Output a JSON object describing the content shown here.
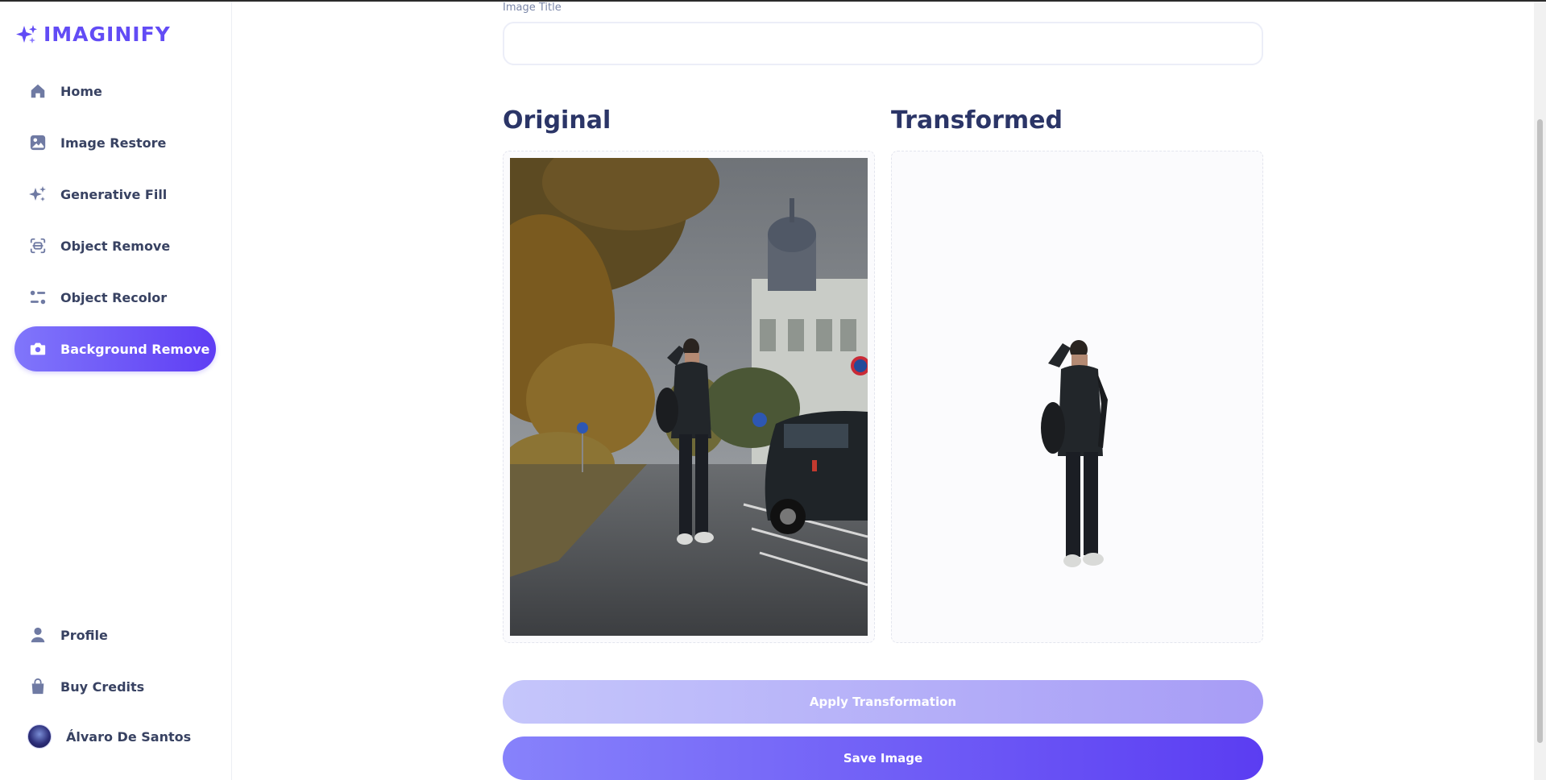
{
  "app": {
    "name": "IMAGINIFY",
    "brand_color": "#624cf5"
  },
  "sidebar": {
    "items": [
      {
        "label": "Home",
        "icon": "home-icon"
      },
      {
        "label": "Image Restore",
        "icon": "image-icon"
      },
      {
        "label": "Generative Fill",
        "icon": "stars-icon"
      },
      {
        "label": "Object Remove",
        "icon": "scan-icon"
      },
      {
        "label": "Object Recolor",
        "icon": "filter-icon"
      },
      {
        "label": "Background Remove",
        "icon": "camera-icon",
        "active": true
      }
    ],
    "bottom_items": [
      {
        "label": "Profile",
        "icon": "user-icon"
      },
      {
        "label": "Buy Credits",
        "icon": "bag-icon"
      }
    ],
    "user": {
      "name": "Álvaro De Santos"
    }
  },
  "form": {
    "title_label": "Image Title",
    "title_value": "",
    "original_heading": "Original",
    "transformed_heading": "Transformed",
    "apply_label": "Apply Transformation",
    "save_label": "Save Image"
  }
}
